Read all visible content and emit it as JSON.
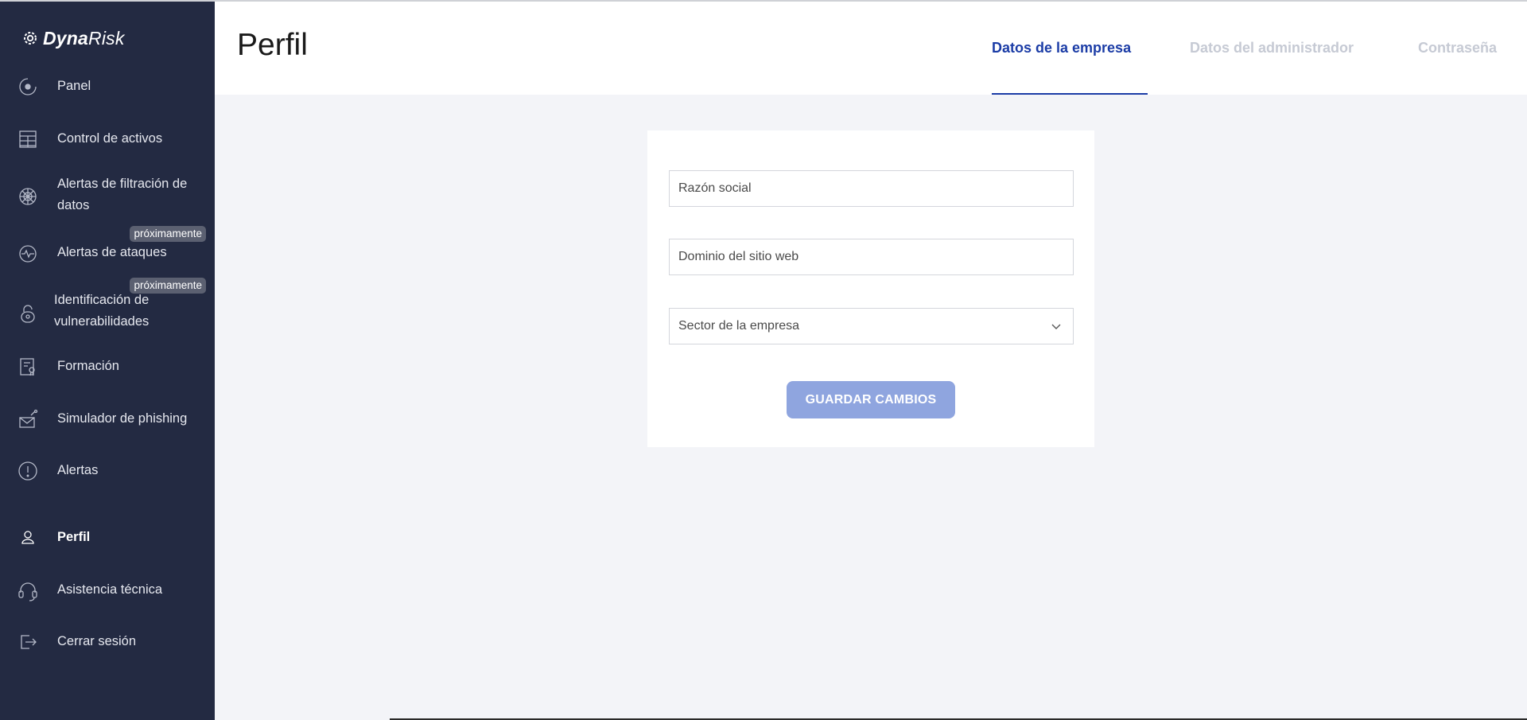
{
  "brand": {
    "name_bold": "Dyna",
    "name_light": "Risk",
    "icon": "gear-logo-icon"
  },
  "sidebar": {
    "items": [
      {
        "label": "Panel",
        "icon": "dashboard-icon"
      },
      {
        "label": "Control de activos",
        "icon": "table-icon"
      },
      {
        "label": "Alertas de filtración de datos",
        "icon": "web-icon"
      },
      {
        "label": "Alertas de ataques",
        "icon": "pulse-icon",
        "badge": "próximamente"
      },
      {
        "label": "Identificación de vulnerabilidades",
        "icon": "lock-icon",
        "badge": "próximamente"
      },
      {
        "label": "Formación",
        "icon": "certificate-icon"
      },
      {
        "label": "Simulador de phishing",
        "icon": "phishing-icon"
      },
      {
        "label": "Alertas",
        "icon": "alert-icon"
      },
      {
        "label": "Perfil",
        "icon": "user-icon",
        "active": true
      },
      {
        "label": "Asistencia técnica",
        "icon": "headset-icon"
      },
      {
        "label": "Cerrar sesión",
        "icon": "logout-icon"
      }
    ]
  },
  "header": {
    "title": "Perfil",
    "tabs": [
      {
        "label": "Datos de la empresa",
        "active": true
      },
      {
        "label": "Datos del administrador",
        "active": false
      },
      {
        "label": "Contraseña",
        "active": false
      }
    ]
  },
  "form": {
    "company_name_placeholder": "Razón social",
    "website_domain_placeholder": "Dominio del sitio web",
    "sector_placeholder": "Sector de la empresa",
    "save_label": "GUARDAR CAMBIOS"
  },
  "colors": {
    "sidebar_bg": "#232a42",
    "accent": "#1b3ca6",
    "button_bg": "#8fa5df",
    "page_bg": "#f3f4f8"
  }
}
